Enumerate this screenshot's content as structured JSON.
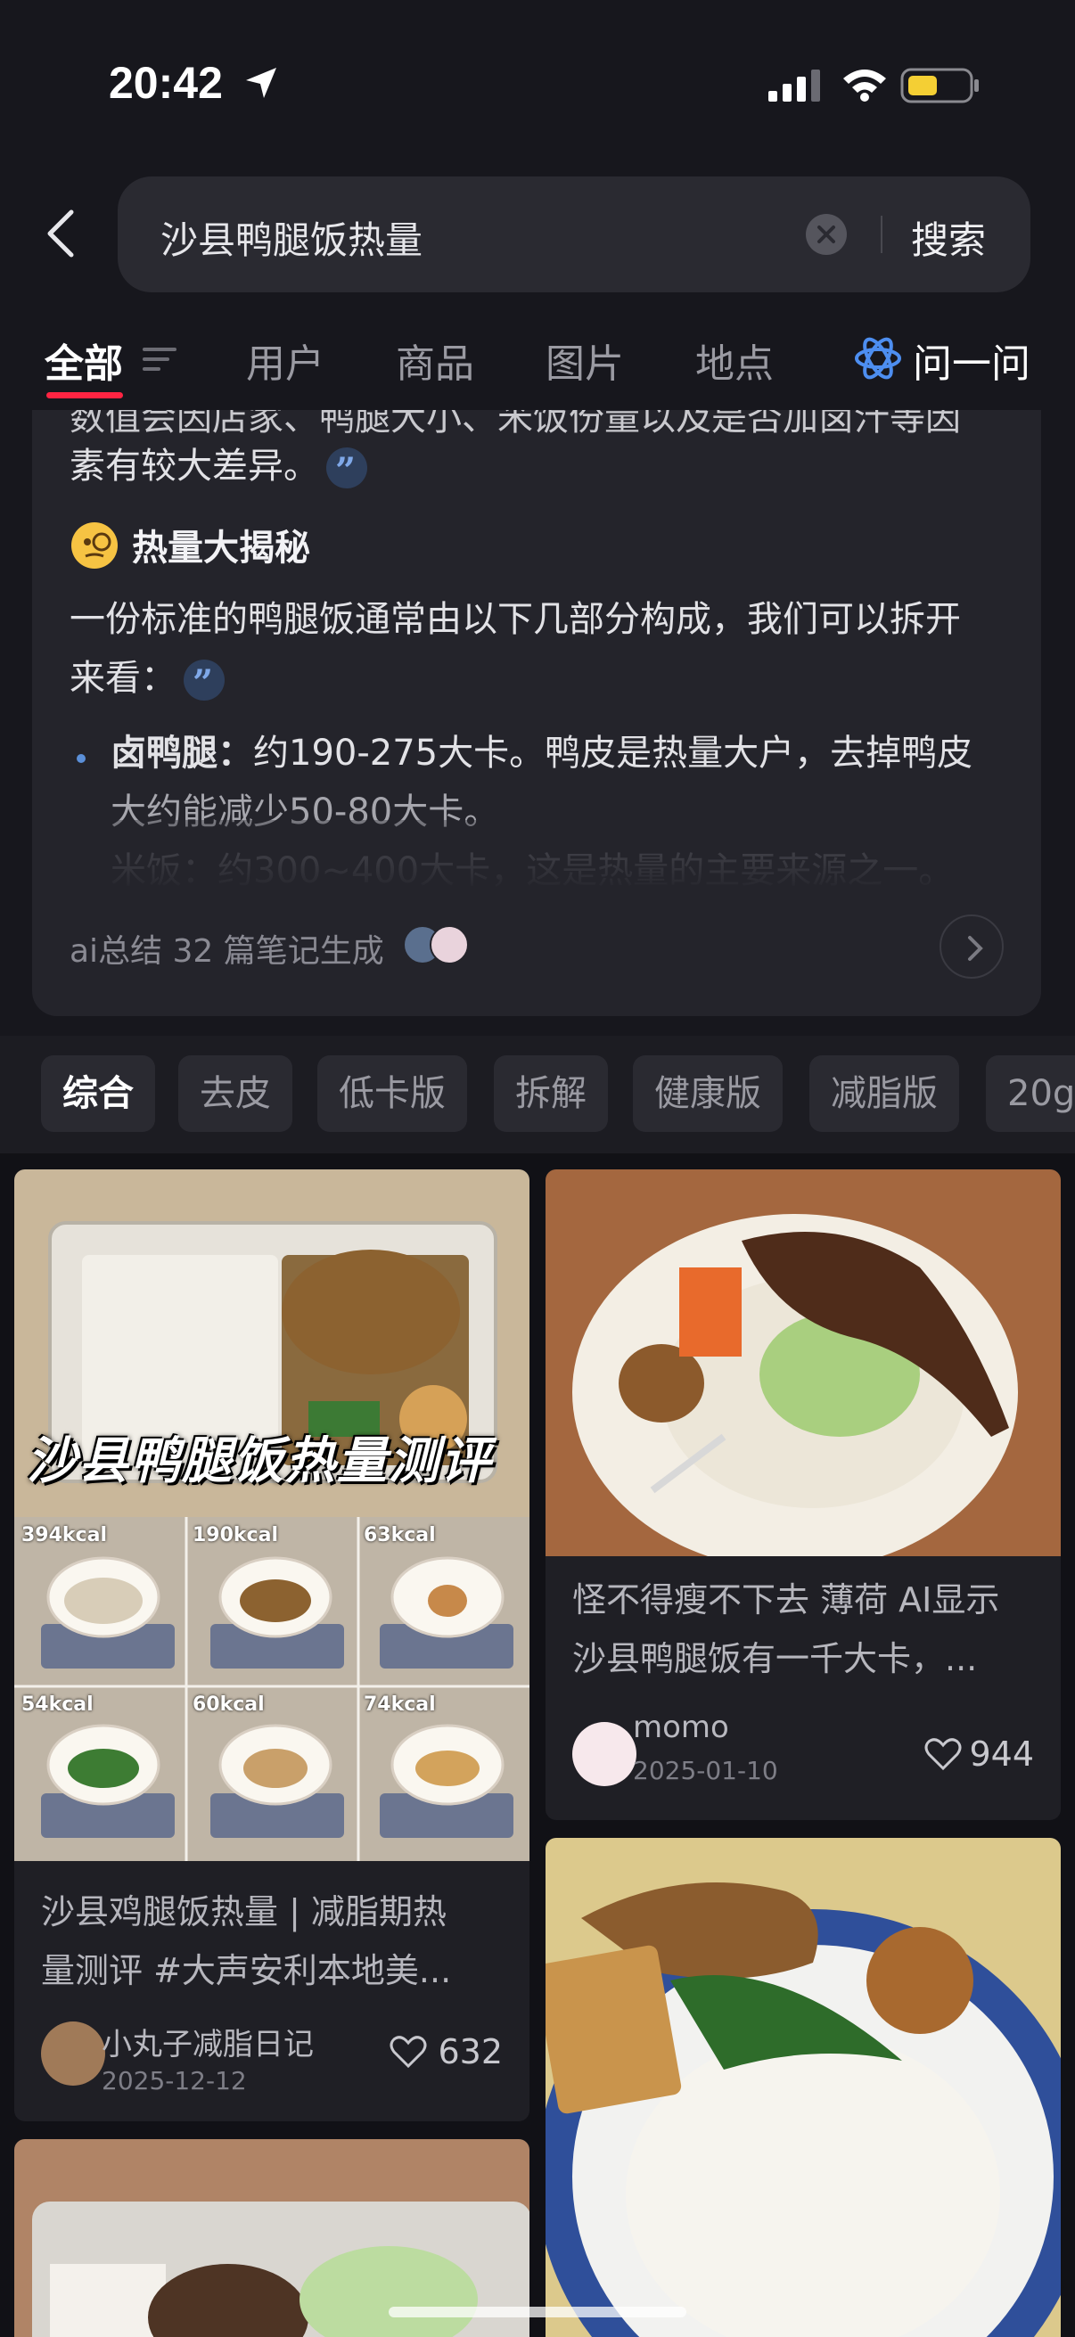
{
  "status": {
    "time": "20:42"
  },
  "search": {
    "query": "沙县鸭腿饭热量",
    "submit": "搜索"
  },
  "tabs": [
    {
      "label": "全部"
    },
    {
      "label": "用户"
    },
    {
      "label": "商品"
    },
    {
      "label": "图片"
    },
    {
      "label": "地点"
    },
    {
      "label": "问一问"
    }
  ],
  "ai_card": {
    "truncated_top": "数值会因店家、鸭腿大小、米饭份量以及是否加卤汁等因",
    "line_2": "素有较大差异。",
    "heading": "热量大揭秘",
    "intro_1": "一份标准的鸭腿饭通常由以下几部分构成，我们可以拆开",
    "intro_2": "来看：",
    "bullet_1_bold": "卤鸭腿：",
    "bullet_1_text": "约190-275大卡。鸭皮是热量大户，去掉鸭皮",
    "bullet_1_cont": "大约能减少50-80大卡。",
    "bullet_2_fade": "米饭：约300~400大卡，这是热量的主要来源之一。",
    "footer": "ai总结 32 篇笔记生成"
  },
  "chips": [
    "综合",
    "去皮",
    "低卡版",
    "拆解",
    "健康版",
    "减脂版",
    "20g"
  ],
  "posts": [
    {
      "overlay": "沙县鸭腿饭热量测评",
      "kcal": [
        "394kcal",
        "190kcal",
        "63kcal",
        "54kcal",
        "60kcal",
        "74kcal"
      ],
      "title_1": "沙县鸡腿饭热量 | 减脂期热",
      "title_2": "量测评 #大声安利本地美...",
      "author": "小丸子减脂日记",
      "date": "2025-12-12",
      "likes": "632"
    },
    {
      "title_1": "怪不得瘦不下去 薄荷 AI显示",
      "title_2": "沙县鸭腿饭有一千大卡，...",
      "author": "momo",
      "date": "2025-01-10",
      "likes": "944"
    }
  ],
  "colors": {
    "accent": "#ff2442",
    "background": "#17171d",
    "card": "#24242b"
  }
}
